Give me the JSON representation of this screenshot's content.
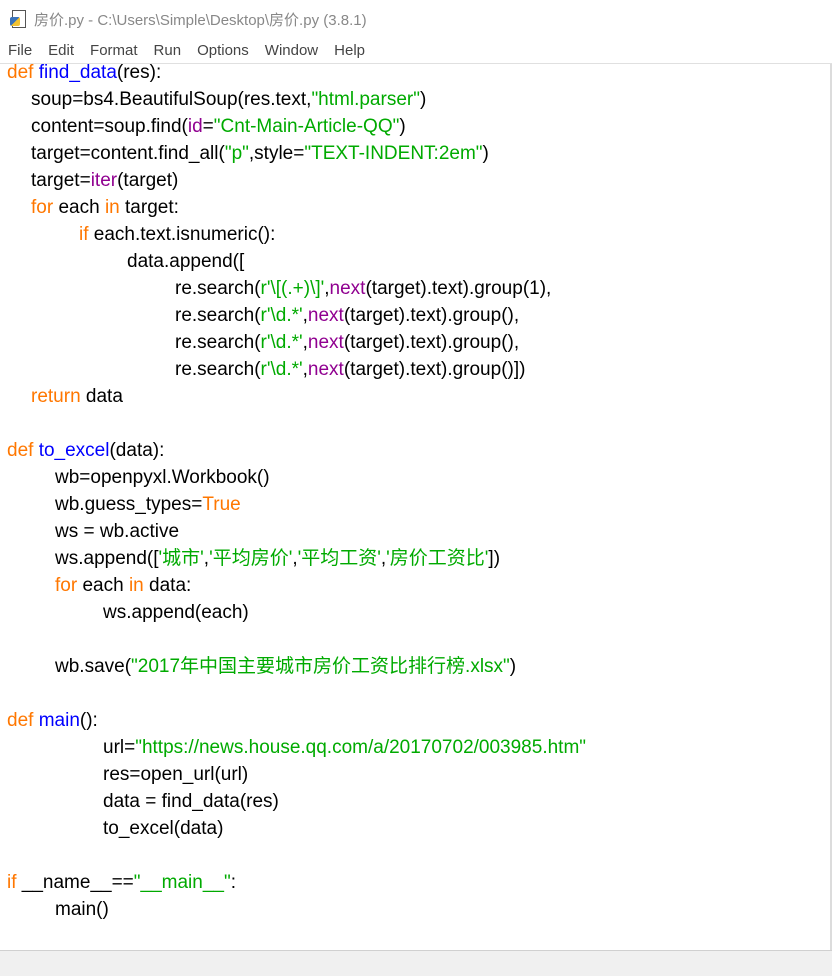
{
  "window": {
    "title": "房价.py - C:\\Users\\Simple\\Desktop\\房价.py (3.8.1)"
  },
  "menu": [
    "File",
    "Edit",
    "Format",
    "Run",
    "Options",
    "Window",
    "Help"
  ],
  "code": [
    {
      "indent": 0,
      "tokens": [
        [
          "kw",
          "def "
        ],
        [
          "fn",
          "find_data"
        ],
        [
          "",
          "(res):"
        ]
      ]
    },
    {
      "indent": 1,
      "tokens": [
        [
          "",
          "soup=bs4.BeautifulSoup(res.text,"
        ],
        [
          "st",
          "\"html.parser\""
        ],
        [
          "",
          ")"
        ]
      ]
    },
    {
      "indent": 1,
      "tokens": [
        [
          "",
          "content=soup.find("
        ],
        [
          "bi",
          "id"
        ],
        [
          "",
          "="
        ],
        [
          "st",
          "\"Cnt-Main-Article-QQ\""
        ],
        [
          "",
          ")"
        ]
      ]
    },
    {
      "indent": 1,
      "tokens": [
        [
          "",
          "target=content.find_all("
        ],
        [
          "st",
          "\"p\""
        ],
        [
          "",
          ",style="
        ],
        [
          "st",
          "\"TEXT-INDENT:2em\""
        ],
        [
          "",
          ")"
        ]
      ]
    },
    {
      "indent": 1,
      "tokens": [
        [
          "",
          "target="
        ],
        [
          "bi",
          "iter"
        ],
        [
          "",
          "(target)"
        ]
      ]
    },
    {
      "indent": 1,
      "tokens": [
        [
          "kw",
          "for"
        ],
        [
          "",
          " each "
        ],
        [
          "kw",
          "in"
        ],
        [
          "",
          " target:"
        ]
      ]
    },
    {
      "indent": 3,
      "tokens": [
        [
          "kw",
          "if"
        ],
        [
          "",
          " each.text.isnumeric():"
        ]
      ]
    },
    {
      "indent": 5,
      "tokens": [
        [
          "",
          "data.append(["
        ]
      ]
    },
    {
      "indent": 7,
      "tokens": [
        [
          "",
          "re.search("
        ],
        [
          "st",
          "r'\\[(.+)\\]'"
        ],
        [
          "",
          ","
        ],
        [
          "bi",
          "next"
        ],
        [
          "",
          "(target).text).group(1),"
        ]
      ]
    },
    {
      "indent": 7,
      "tokens": [
        [
          "",
          "re.search("
        ],
        [
          "st",
          "r'\\d.*'"
        ],
        [
          "",
          ","
        ],
        [
          "bi",
          "next"
        ],
        [
          "",
          "(target).text).group(),"
        ]
      ]
    },
    {
      "indent": 7,
      "tokens": [
        [
          "",
          "re.search("
        ],
        [
          "st",
          "r'\\d.*'"
        ],
        [
          "",
          ","
        ],
        [
          "bi",
          "next"
        ],
        [
          "",
          "(target).text).group(),"
        ]
      ]
    },
    {
      "indent": 7,
      "tokens": [
        [
          "",
          "re.search("
        ],
        [
          "st",
          "r'\\d.*'"
        ],
        [
          "",
          ","
        ],
        [
          "bi",
          "next"
        ],
        [
          "",
          "(target).text).group()])"
        ]
      ]
    },
    {
      "indent": 1,
      "tokens": [
        [
          "kw",
          "return"
        ],
        [
          "",
          " data"
        ]
      ]
    },
    {
      "indent": 0,
      "tokens": []
    },
    {
      "indent": 0,
      "tokens": [
        [
          "kw",
          "def "
        ],
        [
          "fn",
          "to_excel"
        ],
        [
          "",
          "(data):"
        ]
      ]
    },
    {
      "indent": 2,
      "tokens": [
        [
          "",
          "wb=openpyxl.Workbook()"
        ]
      ]
    },
    {
      "indent": 2,
      "tokens": [
        [
          "",
          "wb.guess_types="
        ],
        [
          "kw",
          "True"
        ]
      ]
    },
    {
      "indent": 2,
      "tokens": [
        [
          "",
          "ws = wb.active"
        ]
      ]
    },
    {
      "indent": 2,
      "tokens": [
        [
          "",
          "ws.append(["
        ],
        [
          "st",
          "'城市'"
        ],
        [
          "",
          ","
        ],
        [
          "st",
          "'平均房价'"
        ],
        [
          "",
          ","
        ],
        [
          "st",
          "'平均工资'"
        ],
        [
          "",
          ","
        ],
        [
          "st",
          "'房价工资比'"
        ],
        [
          "",
          "])"
        ]
      ]
    },
    {
      "indent": 2,
      "tokens": [
        [
          "kw",
          "for"
        ],
        [
          "",
          " each "
        ],
        [
          "kw",
          "in"
        ],
        [
          "",
          " data:"
        ]
      ]
    },
    {
      "indent": 4,
      "tokens": [
        [
          "",
          "ws.append(each)"
        ]
      ]
    },
    {
      "indent": 0,
      "tokens": []
    },
    {
      "indent": 2,
      "tokens": [
        [
          "",
          "wb.save("
        ],
        [
          "st",
          "\"2017年中国主要城市房价工资比排行榜.xlsx\""
        ],
        [
          "",
          ")"
        ]
      ]
    },
    {
      "indent": 0,
      "tokens": []
    },
    {
      "indent": 0,
      "tokens": [
        [
          "kw",
          "def "
        ],
        [
          "fn",
          "main"
        ],
        [
          "",
          "():"
        ]
      ]
    },
    {
      "indent": 4,
      "tokens": [
        [
          "",
          "url="
        ],
        [
          "st",
          "\"https://news.house.qq.com/a/20170702/003985.htm\""
        ]
      ]
    },
    {
      "indent": 4,
      "tokens": [
        [
          "",
          "res=open_url(url)"
        ]
      ]
    },
    {
      "indent": 4,
      "tokens": [
        [
          "",
          "data = find_data(res)"
        ]
      ]
    },
    {
      "indent": 4,
      "tokens": [
        [
          "",
          "to_excel(data)"
        ]
      ]
    },
    {
      "indent": 0,
      "tokens": []
    },
    {
      "indent": 0,
      "tokens": [
        [
          "kw",
          "if"
        ],
        [
          "",
          " __name__=="
        ],
        [
          "st",
          "\"__main__\""
        ],
        [
          "",
          ":"
        ]
      ]
    },
    {
      "indent": 2,
      "tokens": [
        [
          "",
          "main()"
        ]
      ]
    }
  ]
}
